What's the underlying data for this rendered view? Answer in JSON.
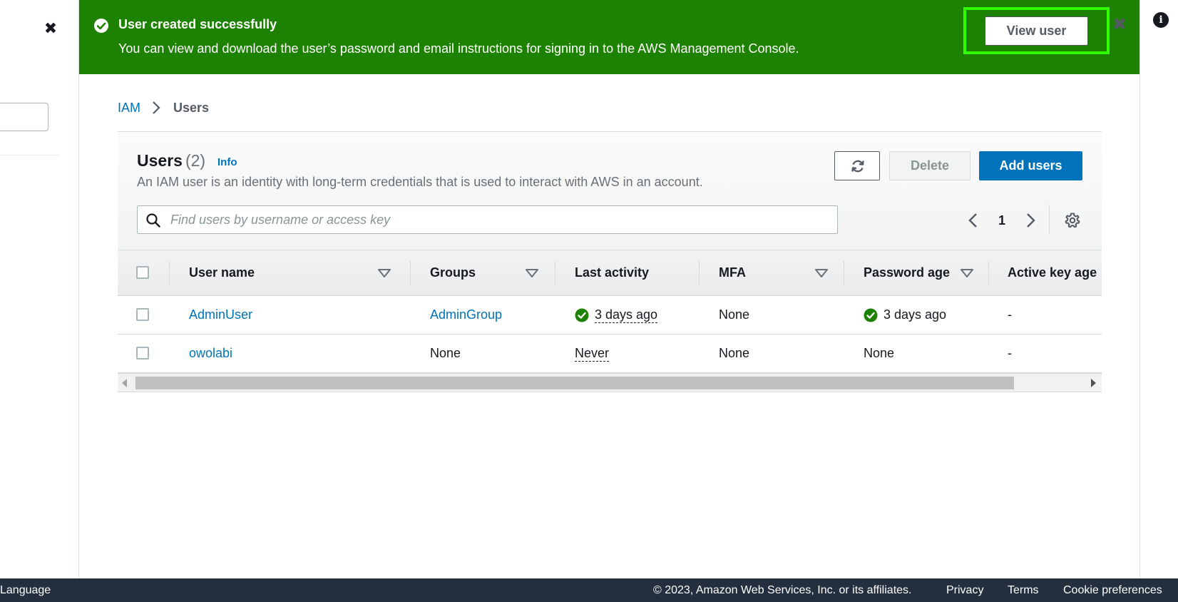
{
  "flash": {
    "title": "User created successfully",
    "message": "You can view and download the user’s password and email instructions for signing in to the AWS Management Console.",
    "view_button": "View user",
    "status_color": "#1d8102"
  },
  "breadcrumb": {
    "items": [
      {
        "label": "IAM"
      },
      {
        "label": "Users"
      }
    ]
  },
  "users_panel": {
    "title": "Users",
    "count": "(2)",
    "info_link": "Info",
    "description": "An IAM user is an identity with long-term credentials that is used to interact with AWS in an account.",
    "delete_button": "Delete",
    "add_button": "Add users",
    "search_placeholder": "Find users by username or access key",
    "current_page": "1"
  },
  "table": {
    "columns": [
      "User name",
      "Groups",
      "Last activity",
      "MFA",
      "Password age",
      "Active key age"
    ],
    "rows": [
      {
        "user_name": "AdminUser",
        "groups": "AdminGroup",
        "last_activity": "3 days ago",
        "mfa": "None",
        "password_age": "3 days ago",
        "active_key_age": "-"
      },
      {
        "user_name": "owolabi",
        "groups": "None",
        "last_activity": "Never",
        "mfa": "None",
        "password_age": "None",
        "active_key_age": "-"
      }
    ]
  },
  "footer": {
    "language": "Language",
    "copyright": "© 2023, Amazon Web Services, Inc. or its affiliates.",
    "privacy": "Privacy",
    "terms": "Terms",
    "cookies": "Cookie preferences"
  },
  "colors": {
    "accent": "#0073bb",
    "success": "#1d8102",
    "footer_bg": "#232f3e",
    "highlight": "#31ff00"
  },
  "icons": [
    "close-icon",
    "info-icon",
    "check-circle-icon",
    "refresh-icon",
    "search-icon",
    "chevron-left-icon",
    "chevron-right-icon",
    "gear-icon",
    "sort-caret-icon"
  ]
}
